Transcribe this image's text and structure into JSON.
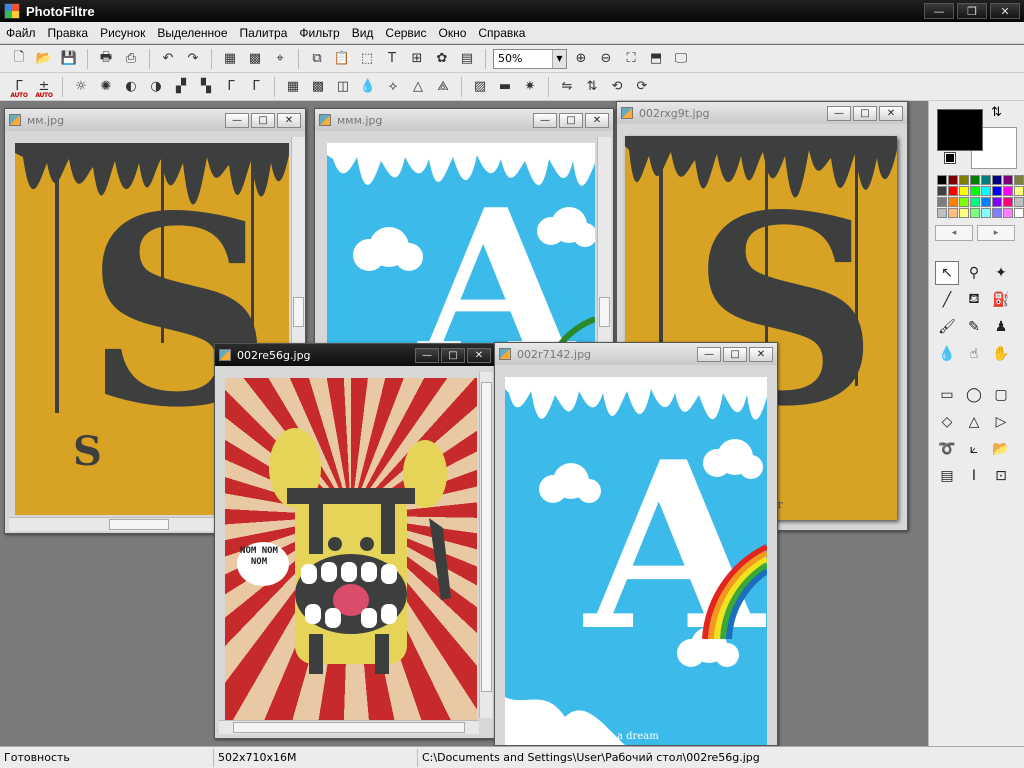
{
  "app": {
    "title": "PhotoFiltre"
  },
  "window_controls": {
    "minimize": "—",
    "maximize": "❐",
    "close": "✕"
  },
  "menu": [
    "Файл",
    "Правка",
    "Рисунок",
    "Выделенное",
    "Палитра",
    "Фильтр",
    "Вид",
    "Сервис",
    "Окно",
    "Справка"
  ],
  "toolbar": {
    "zoom_value": "50%",
    "auto_label": "AUTO"
  },
  "documents": [
    {
      "name": "мм.jpg",
      "active": false
    },
    {
      "name": "ммм.jpg",
      "active": false
    },
    {
      "name": "002rxg9t.jpg",
      "active": false
    },
    {
      "name": "002re56g.jpg",
      "active": true
    },
    {
      "name": "002r7142.jpg",
      "active": false
    }
  ],
  "artwork": {
    "letter_s": "S",
    "letter_a": "A",
    "nom_text": "NOM NOM NOM",
    "a_dream": "a dream",
    "signature": "er"
  },
  "palette_colors": [
    "#000000",
    "#7f0000",
    "#7f7f00",
    "#007f00",
    "#007f7f",
    "#00007f",
    "#7f007f",
    "#7f7f3f",
    "#3f3f3f",
    "#ff0000",
    "#ffff00",
    "#00ff00",
    "#00ffff",
    "#0000ff",
    "#ff00ff",
    "#ffff7f",
    "#7f7f7f",
    "#ff7f00",
    "#7fff00",
    "#00ff7f",
    "#007fff",
    "#7f00ff",
    "#ff007f",
    "#bfbfbf",
    "#bfbfbf",
    "#ffbf7f",
    "#ffff7f",
    "#7fff7f",
    "#7fffff",
    "#7f7fff",
    "#ff7fff",
    "#ffffff"
  ],
  "status": {
    "state": "Готовность",
    "size": "502x710x16M",
    "path": "C:\\Documents and Settings\\User\\Рабочий стол\\002re56g.jpg"
  }
}
